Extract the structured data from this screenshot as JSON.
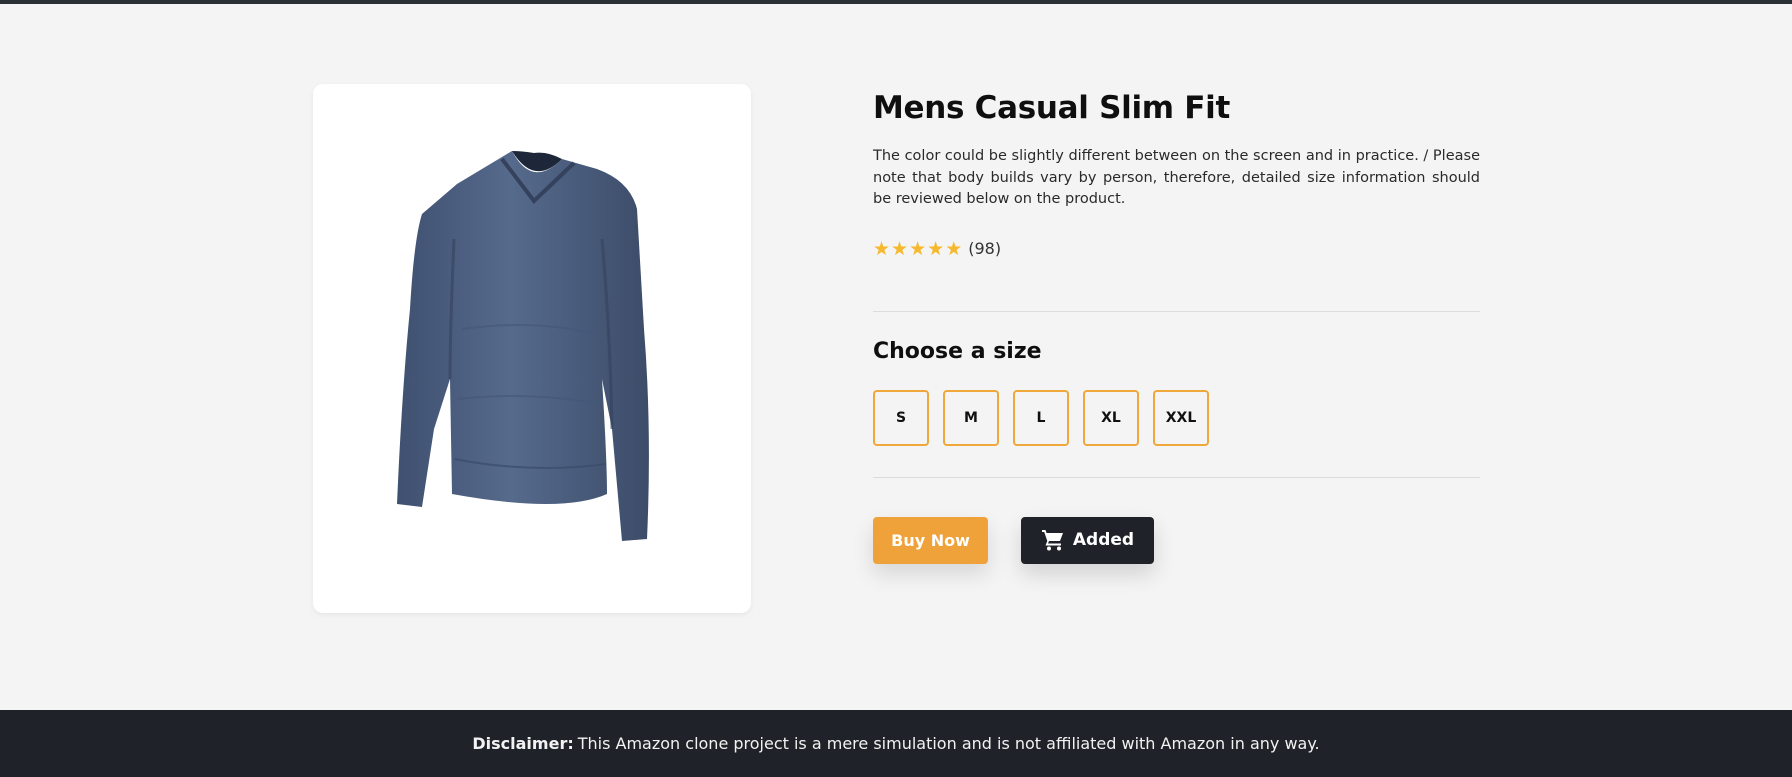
{
  "product": {
    "title": "Mens Casual Slim Fit",
    "description": "The color could be slightly different between on the screen and in practice. / Please note that body builds vary by person, therefore, detailed size information should be reviewed below on the product.",
    "rating_stars": 5,
    "rating_count": "(98)",
    "image_icon": "long-sleeve-shirt"
  },
  "sizes": {
    "heading": "Choose a size",
    "options": [
      "S",
      "M",
      "L",
      "XL",
      "XXL"
    ]
  },
  "actions": {
    "buy_label": "Buy Now",
    "added_label": "Added",
    "cart_icon": "cart-icon"
  },
  "footer": {
    "disclaimer_label": "Disclaimer:",
    "disclaimer_text": "This Amazon clone project is a mere simulation and is not affiliated with Amazon in any way."
  },
  "colors": {
    "accent": "#f0a23a",
    "dark": "#1f2228",
    "star": "#f5b82e",
    "shirt": "#4c5f80"
  }
}
